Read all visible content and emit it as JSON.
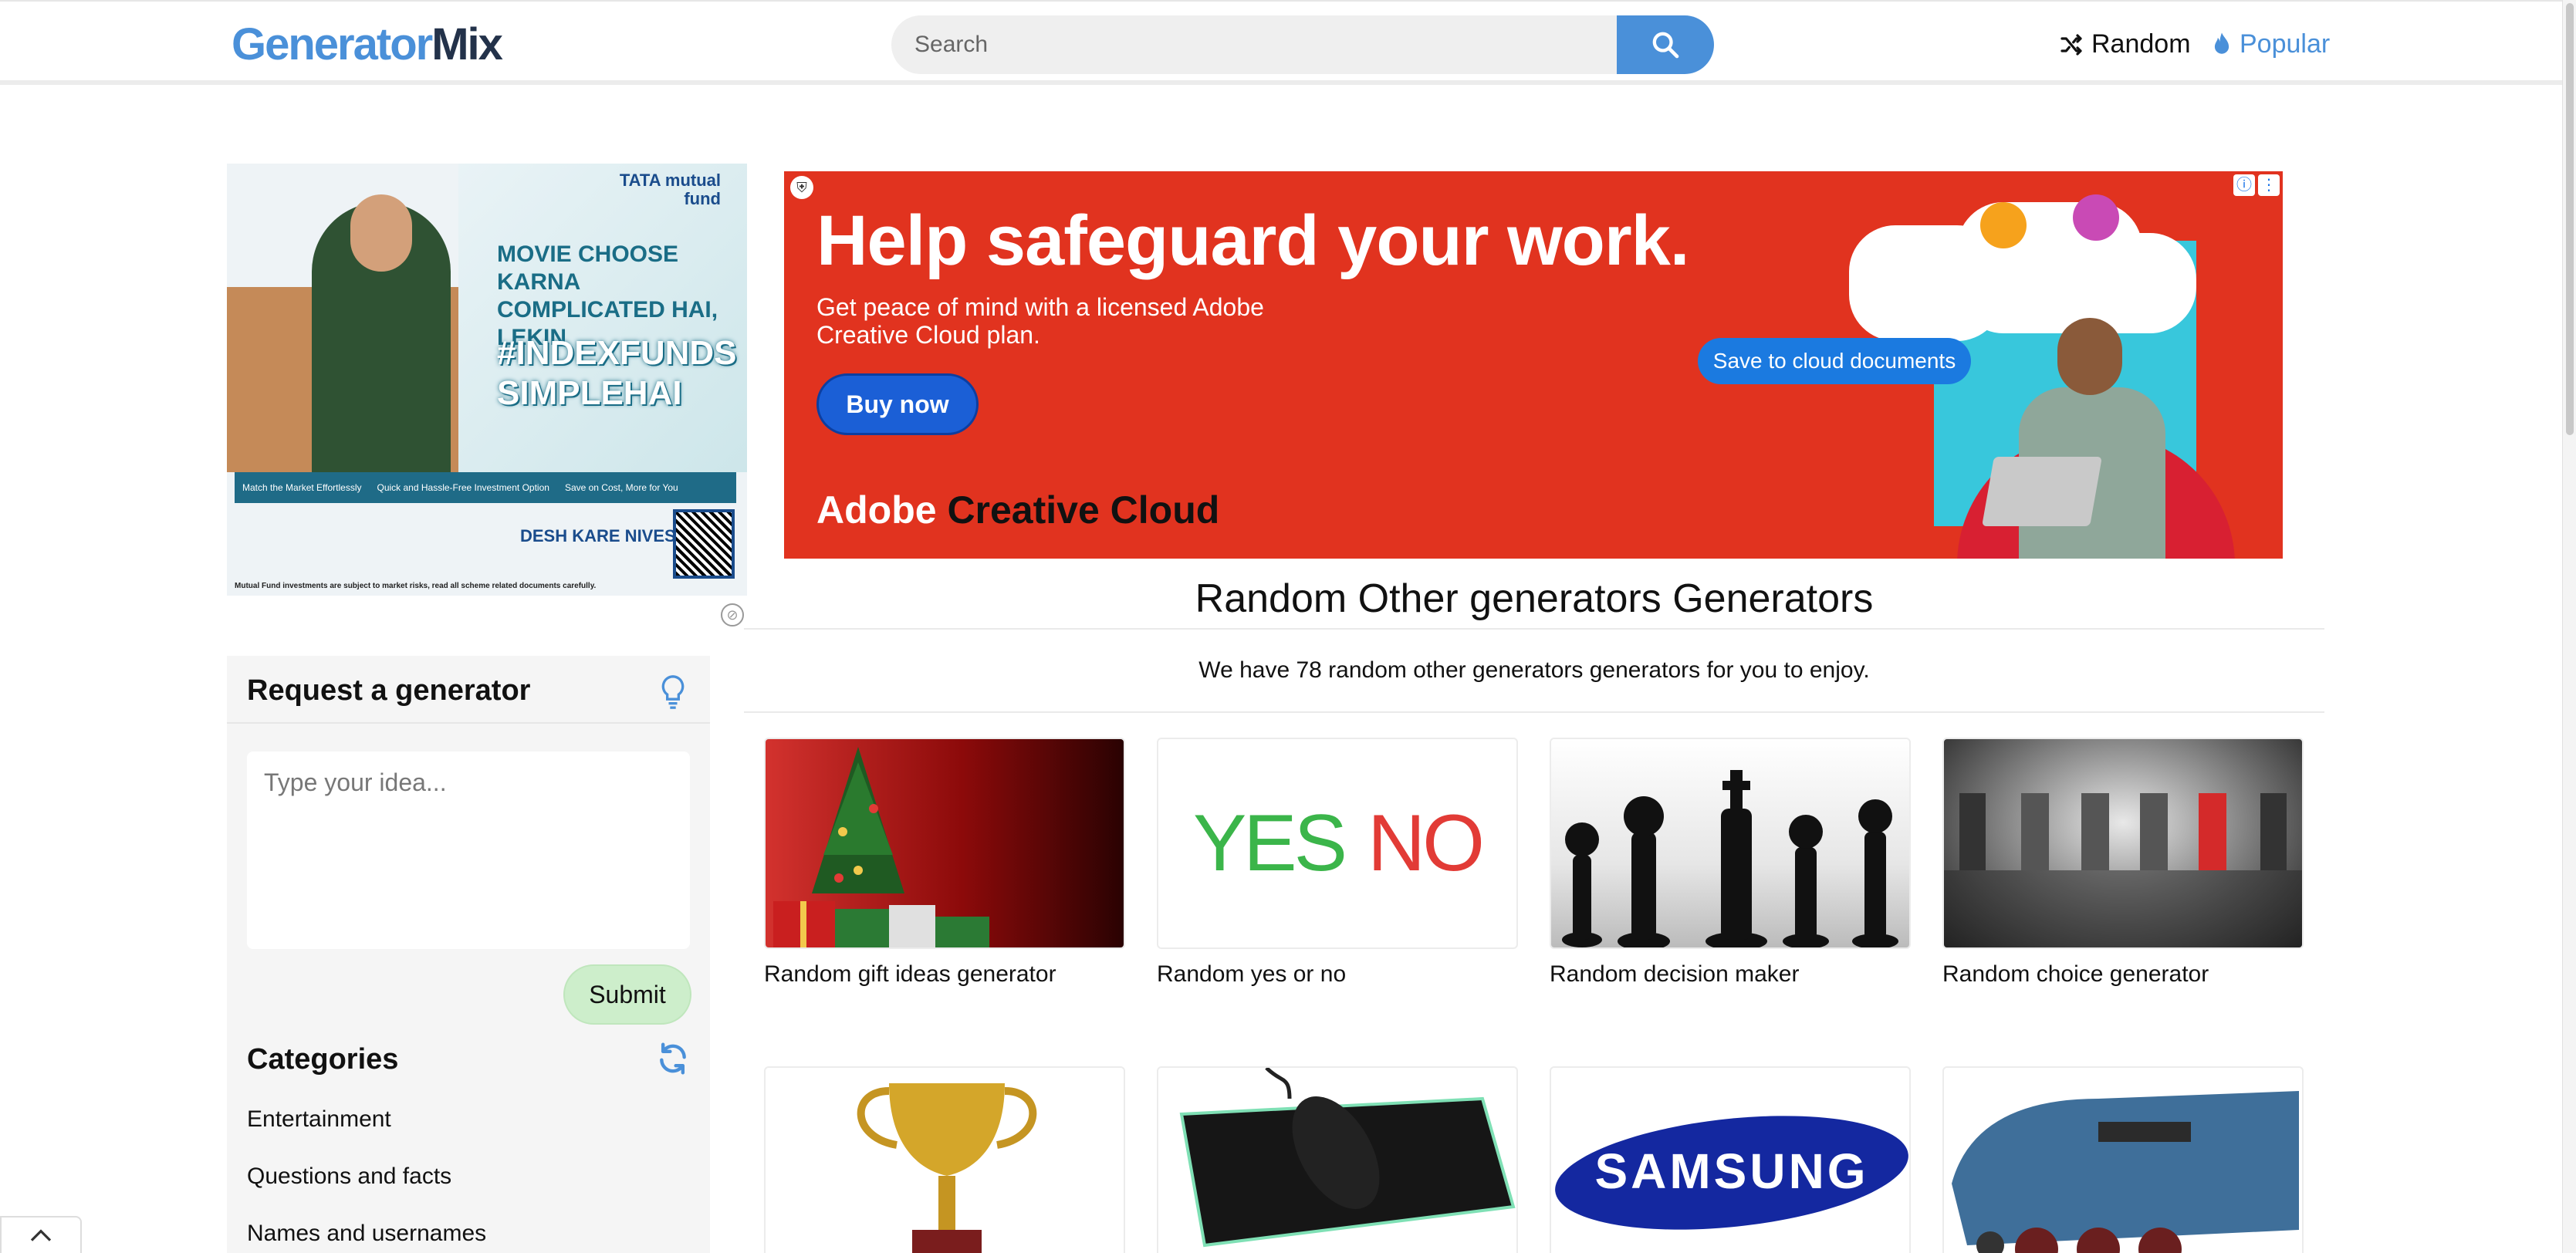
{
  "header": {
    "logo_part1": "Generator",
    "logo_part2": "Mix",
    "search_placeholder": "Search",
    "nav_random": "Random",
    "nav_popular": "Popular"
  },
  "ads": {
    "left": {
      "brand": "TATA mutual fund",
      "headline": "MOVIE CHOOSE KARNA COMPLICATED HAI, LEKIN",
      "tagline": "#INDEXFUNDS SIMPLEHAI",
      "points": [
        "Match the Market Effortlessly",
        "Quick and Hassle-Free Investment Option",
        "Save on Cost, More for You"
      ],
      "campaign": "DESH KARE NIVESH",
      "footer": "Mutual Fund investments are subject to market risks, read all scheme related documents carefully."
    },
    "main": {
      "headline": "Help safeguard your work.",
      "subtext": "Get peace of mind with a licensed Adobe Creative Cloud plan.",
      "cta": "Buy now",
      "cloud_label": "Save to cloud documents",
      "brand_a": "Adobe ",
      "brand_b": "Creative Cloud"
    }
  },
  "page": {
    "title": "Random Other generators Generators",
    "subtitle": "We have 78 random other generators generators for you to enjoy."
  },
  "sidebar": {
    "request_title": "Request a generator",
    "idea_placeholder": "Type your idea...",
    "submit_label": "Submit",
    "categories_title": "Categories",
    "categories": [
      "Entertainment",
      "Questions and facts",
      "Names and usernames"
    ]
  },
  "generators": [
    {
      "label": "Random gift ideas generator",
      "icon": "christmas-tree"
    },
    {
      "label": "Random yes or no",
      "icon": "yes-no",
      "image_text_yes": "YES",
      "image_text_no": "NO"
    },
    {
      "label": "Random decision maker",
      "icon": "chess-pieces"
    },
    {
      "label": "Random choice generator",
      "icon": "doors"
    },
    {
      "label": "",
      "icon": "trophy"
    },
    {
      "label": "",
      "icon": "gaming-mouse"
    },
    {
      "label": "",
      "icon": "samsung-logo",
      "image_text": "SAMSUNG"
    },
    {
      "label": "",
      "icon": "steam-locomotive"
    }
  ],
  "colors": {
    "accent": "#4a90d9",
    "logo_dark": "#23324a",
    "submit_bg": "#cdeecb",
    "ad_red": "#e1331f"
  }
}
